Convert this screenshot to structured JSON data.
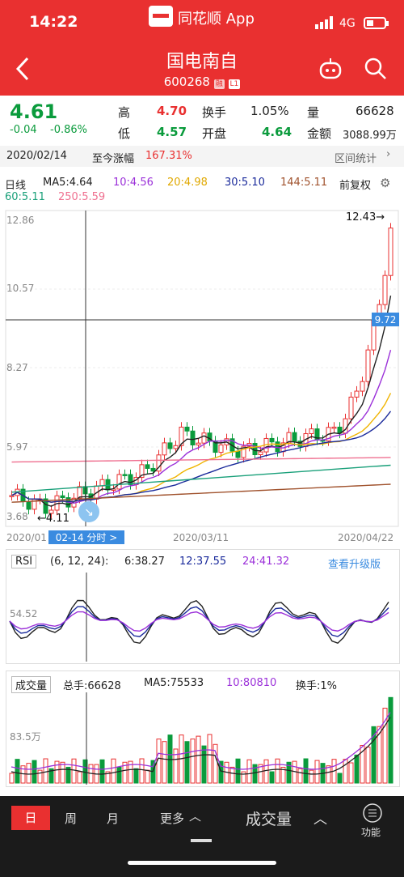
{
  "status": {
    "time": "14:22",
    "app_name": "同花顺 App",
    "network": "4G"
  },
  "header": {
    "title": "国电南自",
    "code": "600268",
    "tag1": "融",
    "tag2": "L1"
  },
  "quote": {
    "price": "4.61",
    "change": "-0.04",
    "change_pct": "-0.86%",
    "high_label": "高",
    "high": "4.70",
    "low_label": "低",
    "low": "4.57",
    "turnover_label": "换手",
    "turnover": "1.05%",
    "open_label": "开盘",
    "open": "4.64",
    "volume_label": "量",
    "volume": "66628",
    "amount_label": "金额",
    "amount": "3088.99万"
  },
  "range": {
    "date": "2020/02/14",
    "label": "至今涨幅",
    "value": "167.31%",
    "stats_label": "区间统计"
  },
  "ma_legend": {
    "period": "日线",
    "ma5": "MA5:4.64",
    "ma10": "10:4.56",
    "ma20": "20:4.98",
    "ma30": "30:5.10",
    "ma144": "144:5.11",
    "ma60": "60:5.11",
    "ma250": "250:5.59",
    "adjust": "前复权"
  },
  "price_chart": {
    "y_labels": [
      "12.86",
      "10.57",
      "8.27",
      "5.97",
      "3.68"
    ],
    "high_marker": "12.43→",
    "low_marker": "←4.11",
    "crosshair_value": "9.72",
    "x_labels": [
      "2020/01",
      "2020/03/11",
      "2020/04/22"
    ],
    "cursor_date": "02-14 分时 >"
  },
  "rsi": {
    "name": "RSI",
    "params": "(6, 12, 24):",
    "rsi6": "6:38.27",
    "rsi12": "12:37.55",
    "rsi24": "24:41.32",
    "upgrade": "查看升级版",
    "y_label": "54.52"
  },
  "volume": {
    "name": "成交量",
    "total": "总手:66628",
    "ma5": "MA5:75533",
    "ma10": "10:80810",
    "turnover": "换手:1%",
    "y_label": "83.5万"
  },
  "bottom": {
    "day": "日",
    "week": "周",
    "month": "月",
    "more": "更多",
    "indicator": "成交量",
    "func": "功能"
  },
  "colors": {
    "up": "#e93030",
    "down": "#0a9b3c",
    "ma5": "#222222",
    "ma10": "#9b30d9",
    "ma20": "#f0b400",
    "ma30": "#1a2a9b",
    "ma144": "#a0522d",
    "ma60": "#1aa07a",
    "ma250": "#ef7090"
  }
}
